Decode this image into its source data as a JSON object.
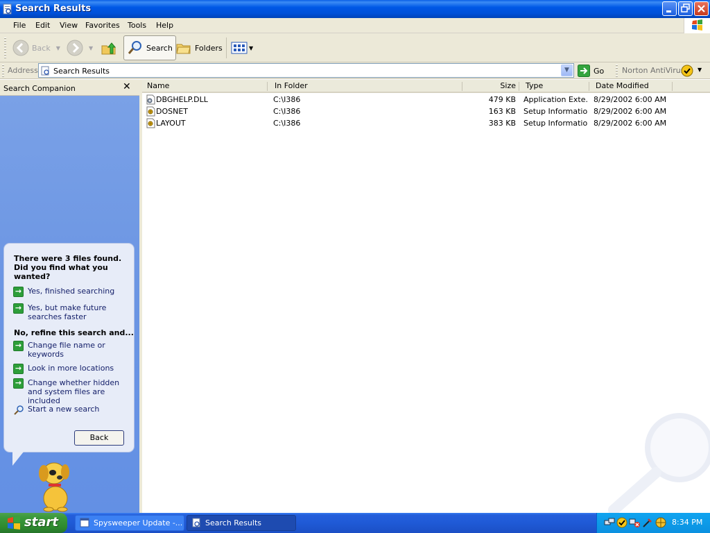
{
  "window": {
    "title": "Search Results",
    "controls": [
      "minimize",
      "maximize",
      "close"
    ]
  },
  "menu": [
    "File",
    "Edit",
    "View",
    "Favorites",
    "Tools",
    "Help"
  ],
  "toolbar": {
    "back": "Back",
    "search": "Search",
    "folders": "Folders"
  },
  "address": {
    "label": "Address",
    "value": "Search Results",
    "go": "Go",
    "norton": "Norton AntiVirus"
  },
  "companion": {
    "title": "Search Companion",
    "found_text": "There were 3 files found. Did you find what you wanted?",
    "options_yes": [
      {
        "label": "Yes, finished searching"
      },
      {
        "label": "Yes, but make future searches faster"
      }
    ],
    "refine_heading": "No, refine this search and...",
    "options_refine": [
      {
        "label": "Change file name or keywords"
      },
      {
        "label": "Look in more locations"
      },
      {
        "label": "Change whether hidden and system files are included"
      }
    ],
    "new_search": "Start a new search",
    "back_button": "Back"
  },
  "results": {
    "columns": [
      "Name",
      "In Folder",
      "Size",
      "Type",
      "Date Modified"
    ],
    "rows": [
      {
        "name": "DBGHELP.DLL",
        "folder": "C:\\I386",
        "size": "479 KB",
        "type": "Application Exte...",
        "date": "8/29/2002 6:00 AM",
        "icon": "dll-file-icon"
      },
      {
        "name": "DOSNET",
        "folder": "C:\\I386",
        "size": "163 KB",
        "type": "Setup Information",
        "date": "8/29/2002 6:00 AM",
        "icon": "setup-info-icon"
      },
      {
        "name": "LAYOUT",
        "folder": "C:\\I386",
        "size": "383 KB",
        "type": "Setup Information",
        "date": "8/29/2002 6:00 AM",
        "icon": "setup-info-icon"
      }
    ]
  },
  "taskbar": {
    "start": "start",
    "tasks": [
      {
        "label": "Spysweeper Update -...",
        "active": false
      },
      {
        "label": "Search Results",
        "active": true
      }
    ],
    "clock": "8:34 PM"
  },
  "colors": {
    "title_blue": "#0058e6",
    "pane_blue": "#6b95e3",
    "start_green": "#3c9a3c",
    "arrow_green": "#2d9e3a"
  }
}
